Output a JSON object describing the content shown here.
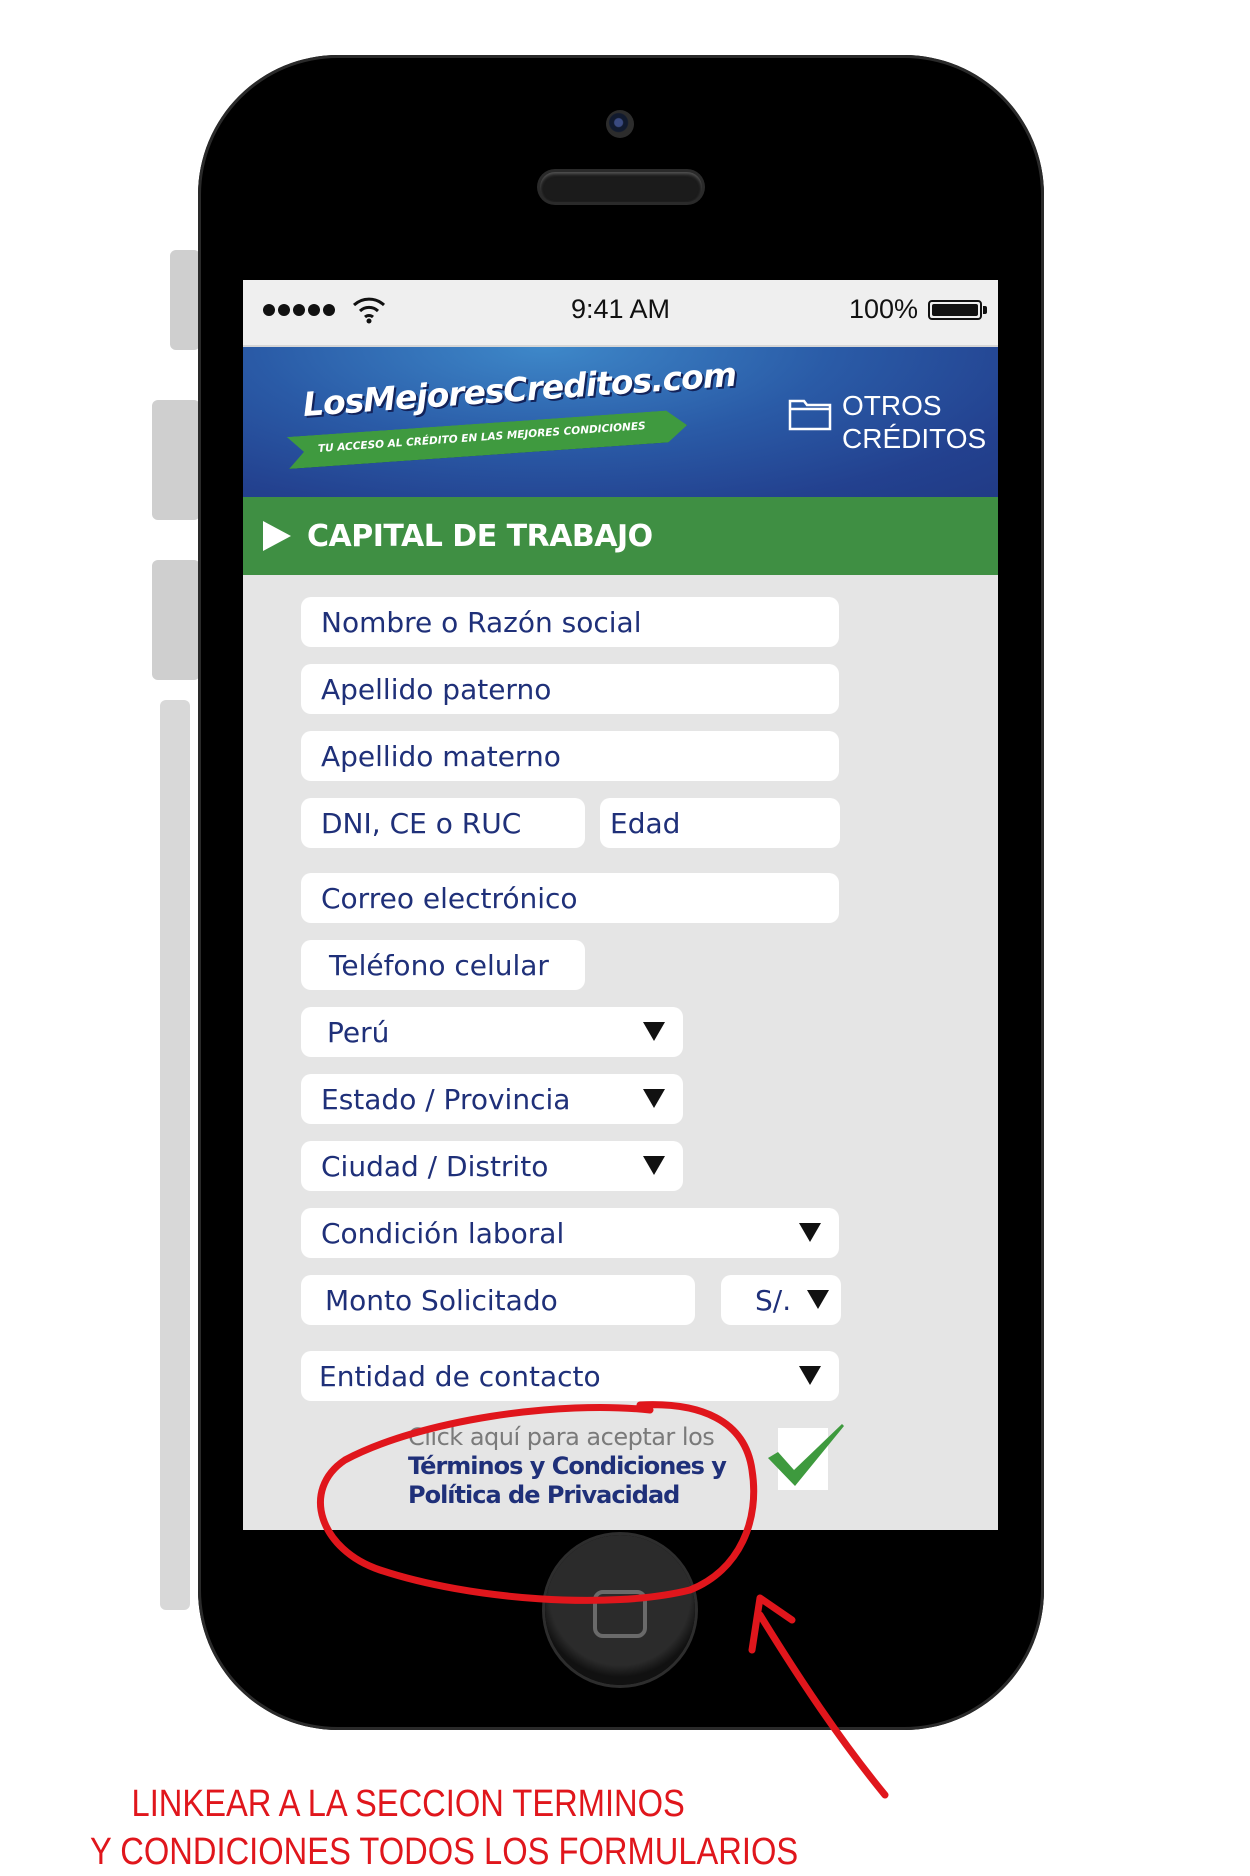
{
  "status_bar": {
    "time": "9:41 AM",
    "battery": "100%"
  },
  "header": {
    "logo": "LosMejoresCreditos.com",
    "tagline": "TU ACCESO AL CRÉDITO EN LAS MEJORES CONDICIONES",
    "menu_label": "OTROS CRÉDITOS"
  },
  "section": {
    "title": "CAPITAL DE TRABAJO"
  },
  "form": {
    "nombre": "Nombre o Razón social",
    "apellido_paterno": "Apellido paterno",
    "apellido_materno": "Apellido materno",
    "documento": "DNI, CE o RUC",
    "edad": "Edad",
    "correo": "Correo electrónico",
    "telefono": "Teléfono celular",
    "pais": "Perú",
    "estado": "Estado / Provincia",
    "ciudad": "Ciudad / Distrito",
    "condicion": "Condición laboral",
    "monto": "Monto Solicitado",
    "moneda": "S/.",
    "entidad": "Entidad de contacto"
  },
  "terms": {
    "line1": "Click aquí para aceptar los",
    "line2": "Términos y Condiciones y",
    "line3": "Política de Privacidad"
  },
  "annotation": {
    "line1": "LINKEAR A LA SECCION TERMINOS",
    "line2": "Y CONDICIONES TODOS LOS FORMULARIOS",
    "color": "#e0161c"
  },
  "colors": {
    "brand_blue": "#23418f",
    "brand_green": "#3f8f43",
    "text_blue": "#1f3079"
  }
}
